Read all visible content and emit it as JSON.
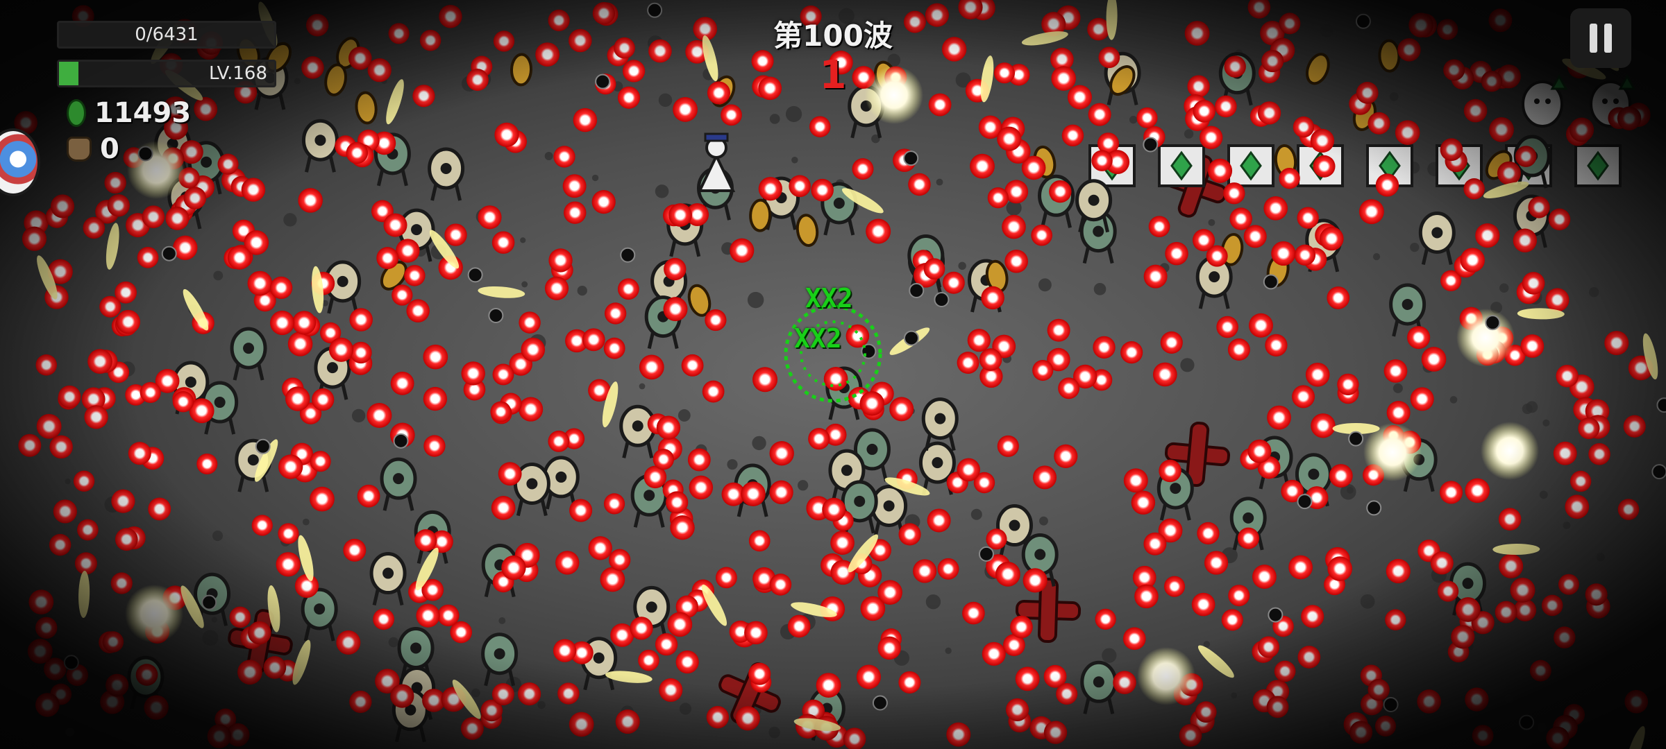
{
  "hud": {
    "exp_text": "0/6431",
    "exp_progress": 0,
    "level_text": "LV.168",
    "level_progress": 0.09,
    "gems": "11493",
    "bags": "0"
  },
  "wave": {
    "label": "第100波",
    "countdown": "1"
  },
  "combo": {
    "top_text": "XX2",
    "bottom_text": "XX2"
  },
  "colors": {
    "bullet": "#ff1a1a",
    "bullet_core": "#ffffff",
    "exp_fill": "#3fae3f",
    "countdown": "#e52020",
    "combo": "#18d018"
  },
  "icons": {
    "pause": "pause-icon",
    "gem": "gem-icon",
    "bag": "bag-icon"
  }
}
